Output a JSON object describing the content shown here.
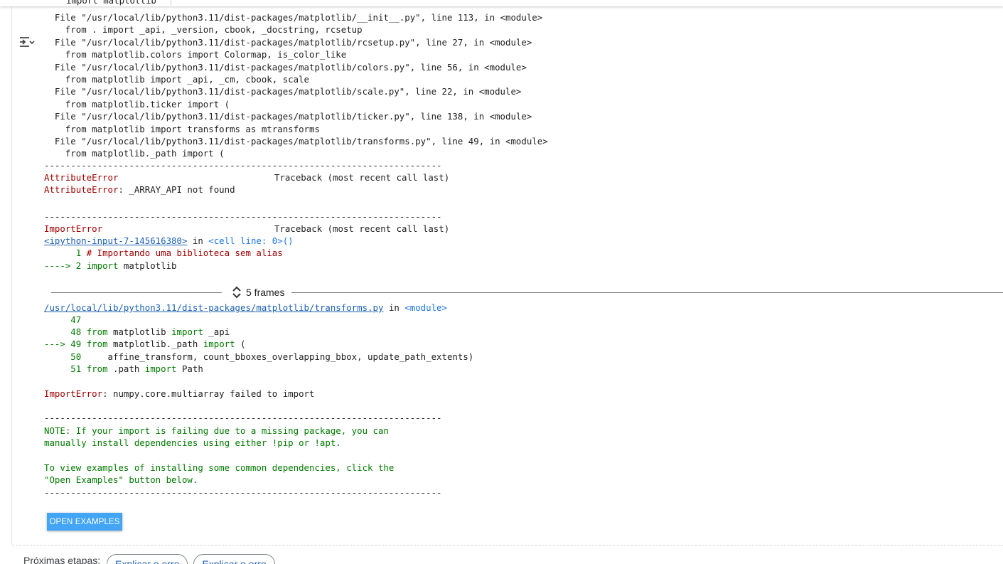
{
  "top_cut_text": "import matplotlib",
  "output_icon": "output-toggle-icon",
  "traceback_top": [
    {
      "text": "  File \"/usr/local/lib/python3.11/dist-packages/matplotlib/__init__.py\", line 113, in <module>"
    },
    {
      "text": "    from . import _api, _version, cbook, _docstring, rcsetup"
    },
    {
      "text": "  File \"/usr/local/lib/python3.11/dist-packages/matplotlib/rcsetup.py\", line 27, in <module>"
    },
    {
      "text": "    from matplotlib.colors import Colormap, is_color_like"
    },
    {
      "text": "  File \"/usr/local/lib/python3.11/dist-packages/matplotlib/colors.py\", line 56, in <module>"
    },
    {
      "text": "    from matplotlib import _api, _cm, cbook, scale"
    },
    {
      "text": "  File \"/usr/local/lib/python3.11/dist-packages/matplotlib/scale.py\", line 22, in <module>"
    },
    {
      "text": "    from matplotlib.ticker import ("
    },
    {
      "text": "  File \"/usr/local/lib/python3.11/dist-packages/matplotlib/ticker.py\", line 138, in <module>"
    },
    {
      "text": "    from matplotlib import transforms as mtransforms"
    },
    {
      "text": "  File \"/usr/local/lib/python3.11/dist-packages/matplotlib/transforms.py\", line 49, in <module>"
    },
    {
      "text": "    from matplotlib._path import ("
    }
  ],
  "separator": "---------------------------------------------------------------------------",
  "attribute_error": {
    "name": "AttributeError",
    "traceback_label": "Traceback (most recent call last)",
    "message_name": "AttributeError",
    "message": ": _ARRAY_API not found"
  },
  "import_error": {
    "name": "ImportError",
    "traceback_label": "Traceback (most recent call last)",
    "input_link": "<ipython-input-7-145616380>",
    "in_word": " in ",
    "cell_link": "<cell line: 0>",
    "parens": "()",
    "code_line_1_no": "      1 ",
    "code_line_1": "# Importando uma biblioteca sem alias",
    "code_line_2_arrow": "----> 2 ",
    "code_line_2_kw": "import",
    "code_line_2_rest": " matplotlib"
  },
  "frames": {
    "label": "5 frames"
  },
  "transforms_frame": {
    "path_link": "/usr/local/lib/python3.11/dist-packages/matplotlib/transforms.py",
    "in_word": " in ",
    "module_link": "<module>",
    "l47": "     47",
    "l48_no": "     48 ",
    "l48_kw1": "from",
    "l48_mid": " matplotlib ",
    "l48_kw2": "import",
    "l48_rest": " _api",
    "l49_arrow": "---> 49 ",
    "l49_kw1": "from",
    "l49_mid": " matplotlib._path ",
    "l49_kw2": "import",
    "l49_rest": " (",
    "l50_no": "     50 ",
    "l50_rest": "    affine_transform, count_bboxes_overlapping_bbox, update_path_extents)",
    "l51_no": "     51 ",
    "l51_kw1": "from",
    "l51_mid": " .path ",
    "l51_kw2": "import",
    "l51_rest": " Path"
  },
  "final_error": {
    "name": "ImportError",
    "message": ": numpy.core.multiarray failed to import"
  },
  "note": {
    "line1": "NOTE: If your import is failing due to a missing package, you can",
    "line2": "manually install dependencies using either !pip or !apt.",
    "line3": "To view examples of installing some common dependencies, click the",
    "line4": "\"Open Examples\" button below."
  },
  "open_examples_label": "OPEN EXAMPLES",
  "next_steps": {
    "label": "Próximas etapas:",
    "chips": [
      "Explicar o erro",
      "Explicar o erro"
    ]
  },
  "colors": {
    "error_red": "#a00000",
    "keyword_green": "#007a00",
    "link_blue": "#1a5fb4",
    "button_blue": "#42a5f5"
  }
}
